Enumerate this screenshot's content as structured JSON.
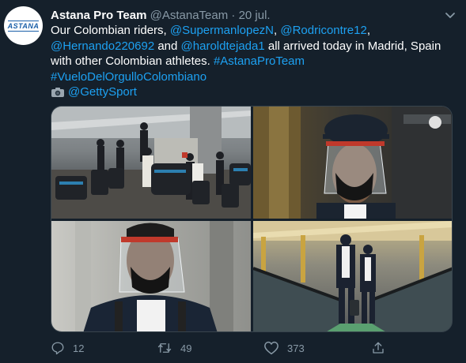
{
  "author": {
    "name": "Astana Pro Team",
    "handle": "@AstanaTeam",
    "separator": "·",
    "date": "20 jul.",
    "avatar_logo_text": "ASTANA"
  },
  "tweet": {
    "line1_text": "Our Colombian riders, ",
    "mention1": "@SupermanlopezN",
    "comma1": ", ",
    "mention2": "@Rodricontre12",
    "comma2": ",",
    "mention3": "@Hernando220692",
    "and": " and ",
    "mention4": "@haroldtejada1",
    "rest": " all arrived today in Madrid, Spain with other Colombian athletes. ",
    "hashtag1": "#AstanaProTeam",
    "hashtag2": "#VueloDelOrgulloColombiano",
    "photo_credit": "@GettySport"
  },
  "actions": {
    "replies": "12",
    "retweets": "49",
    "likes": "373"
  },
  "colors": {
    "background": "#15202b",
    "link": "#1da1f2",
    "muted": "#8899a6",
    "border": "#38444d"
  }
}
